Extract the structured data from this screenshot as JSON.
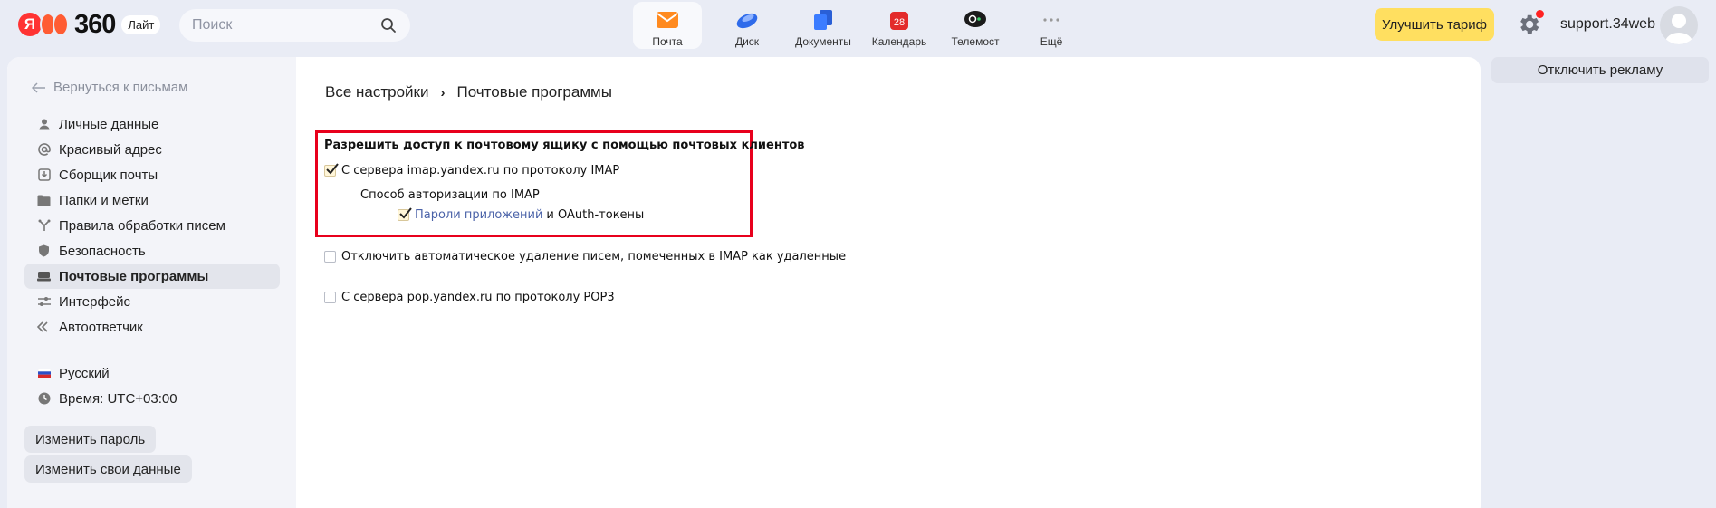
{
  "header": {
    "logo_text": "360",
    "logo_badge": "Лайт",
    "search_placeholder": "Поиск",
    "services": [
      {
        "label": "Почта",
        "icon": "mail-icon",
        "active": true
      },
      {
        "label": "Диск",
        "icon": "disk-icon"
      },
      {
        "label": "Документы",
        "icon": "documents-icon"
      },
      {
        "label": "Календарь",
        "icon": "calendar-icon",
        "badge": "28"
      },
      {
        "label": "Телемост",
        "icon": "telemost-icon"
      },
      {
        "label": "Ещё",
        "icon": "more-icon"
      }
    ],
    "upgrade_label": "Улучшить тариф",
    "username": "support.34web"
  },
  "sidebar": {
    "back_label": "Вернуться к письмам",
    "items": [
      {
        "label": "Личные данные",
        "icon": "person-icon"
      },
      {
        "label": "Красивый адрес",
        "icon": "at-icon"
      },
      {
        "label": "Сборщик почты",
        "icon": "inbox-download-icon"
      },
      {
        "label": "Папки и метки",
        "icon": "folder-icon"
      },
      {
        "label": "Правила обработки писем",
        "icon": "rules-icon"
      },
      {
        "label": "Безопасность",
        "icon": "shield-icon"
      },
      {
        "label": "Почтовые программы",
        "icon": "mail-clients-icon",
        "active": true
      },
      {
        "label": "Интерфейс",
        "icon": "sliders-icon"
      },
      {
        "label": "Автоответчик",
        "icon": "autoreply-icon"
      }
    ],
    "language": "Русский",
    "timezone": "Время: UTC+03:00",
    "change_password": "Изменить пароль",
    "change_data": "Изменить свои данные"
  },
  "main": {
    "breadcrumb_root": "Все настройки",
    "breadcrumb_sep": "›",
    "breadcrumb_current": "Почтовые программы",
    "section_title": "Разрешить доступ к почтовому ящику с помощью почтовых клиентов",
    "imap_label": "С сервера imap.yandex.ru по протоколу IMAP",
    "imap_checked": true,
    "auth_method_label": "Способ авторизации по IMAP",
    "app_passwords_link": "Пароли приложений",
    "app_passwords_suffix": "и OAuth-токены",
    "app_passwords_checked": true,
    "no_autodelete_label": "Отключить автоматическое удаление писем, помеченных в IMAP как удаленные",
    "no_autodelete_checked": false,
    "pop3_label": "С сервера pop.yandex.ru по протоколу POP3",
    "pop3_checked": false
  },
  "right": {
    "disable_ads": "Отключить рекламу"
  },
  "colors": {
    "accent_yellow": "#ffdf60",
    "highlight_red": "#e8001c",
    "link": "#4a62a8"
  }
}
